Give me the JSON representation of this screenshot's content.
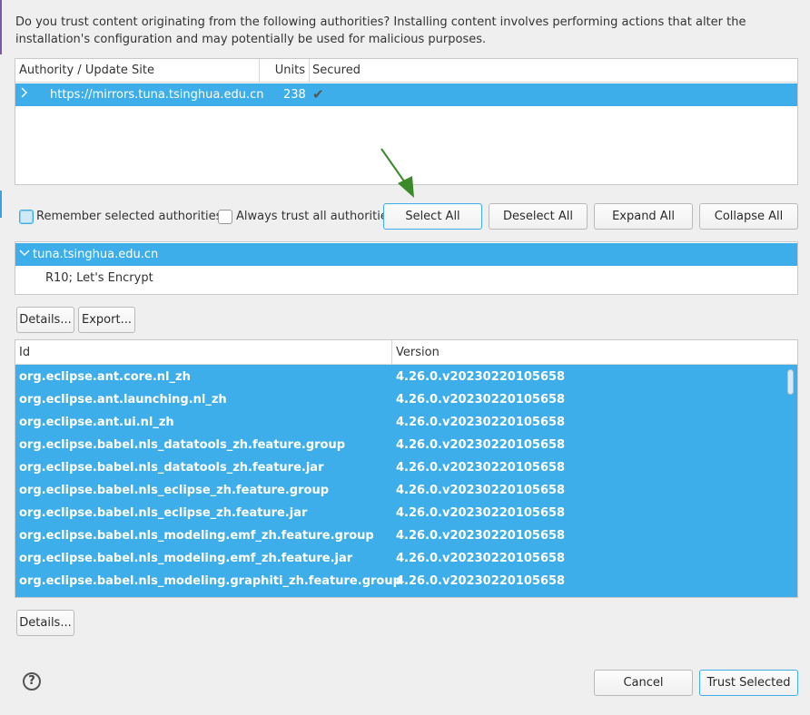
{
  "intro_text": "Do you trust content originating from the following authorities?  Installing content involves performing actions that alter the installation's configuration and may potentially be used for malicious purposes.",
  "authority_table": {
    "columns": [
      "Authority / Update Site",
      "Units",
      "Secured"
    ],
    "rows": [
      {
        "site": "https://mirrors.tuna.tsinghua.edu.cn",
        "units": "238",
        "secured_icon": "check-icon"
      }
    ]
  },
  "options": {
    "remember_label": "Remember selected authorities",
    "always_trust_label": "Always trust all authoritie"
  },
  "buttons": {
    "select_all": "Select All",
    "deselect_all": "Deselect All",
    "expand_all": "Expand All",
    "collapse_all": "Collapse All",
    "details": "Details...",
    "export": "Export...",
    "details2": "Details...",
    "cancel": "Cancel",
    "trust_selected": "Trust Selected"
  },
  "certificate_tree": {
    "root": "tuna.tsinghua.edu.cn",
    "child": "R10; Let's Encrypt"
  },
  "unit_table": {
    "columns": [
      "Id",
      "Version"
    ],
    "rows": [
      {
        "id": "org.eclipse.ant.core.nl_zh",
        "version": "4.26.0.v20230220105658"
      },
      {
        "id": "org.eclipse.ant.launching.nl_zh",
        "version": "4.26.0.v20230220105658"
      },
      {
        "id": "org.eclipse.ant.ui.nl_zh",
        "version": "4.26.0.v20230220105658"
      },
      {
        "id": "org.eclipse.babel.nls_datatools_zh.feature.group",
        "version": "4.26.0.v20230220105658"
      },
      {
        "id": "org.eclipse.babel.nls_datatools_zh.feature.jar",
        "version": "4.26.0.v20230220105658"
      },
      {
        "id": "org.eclipse.babel.nls_eclipse_zh.feature.group",
        "version": "4.26.0.v20230220105658"
      },
      {
        "id": "org.eclipse.babel.nls_eclipse_zh.feature.jar",
        "version": "4.26.0.v20230220105658"
      },
      {
        "id": "org.eclipse.babel.nls_modeling.emf_zh.feature.group",
        "version": "4.26.0.v20230220105658"
      },
      {
        "id": "org.eclipse.babel.nls_modeling.emf_zh.feature.jar",
        "version": "4.26.0.v20230220105658"
      },
      {
        "id": "org.eclipse.babel.nls_modeling.graphiti_zh.feature.group",
        "version": "4.26.0.v20230220105658"
      }
    ]
  },
  "help_icon": "help-icon",
  "colors": {
    "selection": "#3daee9",
    "arrow": "#3a8a2a"
  }
}
